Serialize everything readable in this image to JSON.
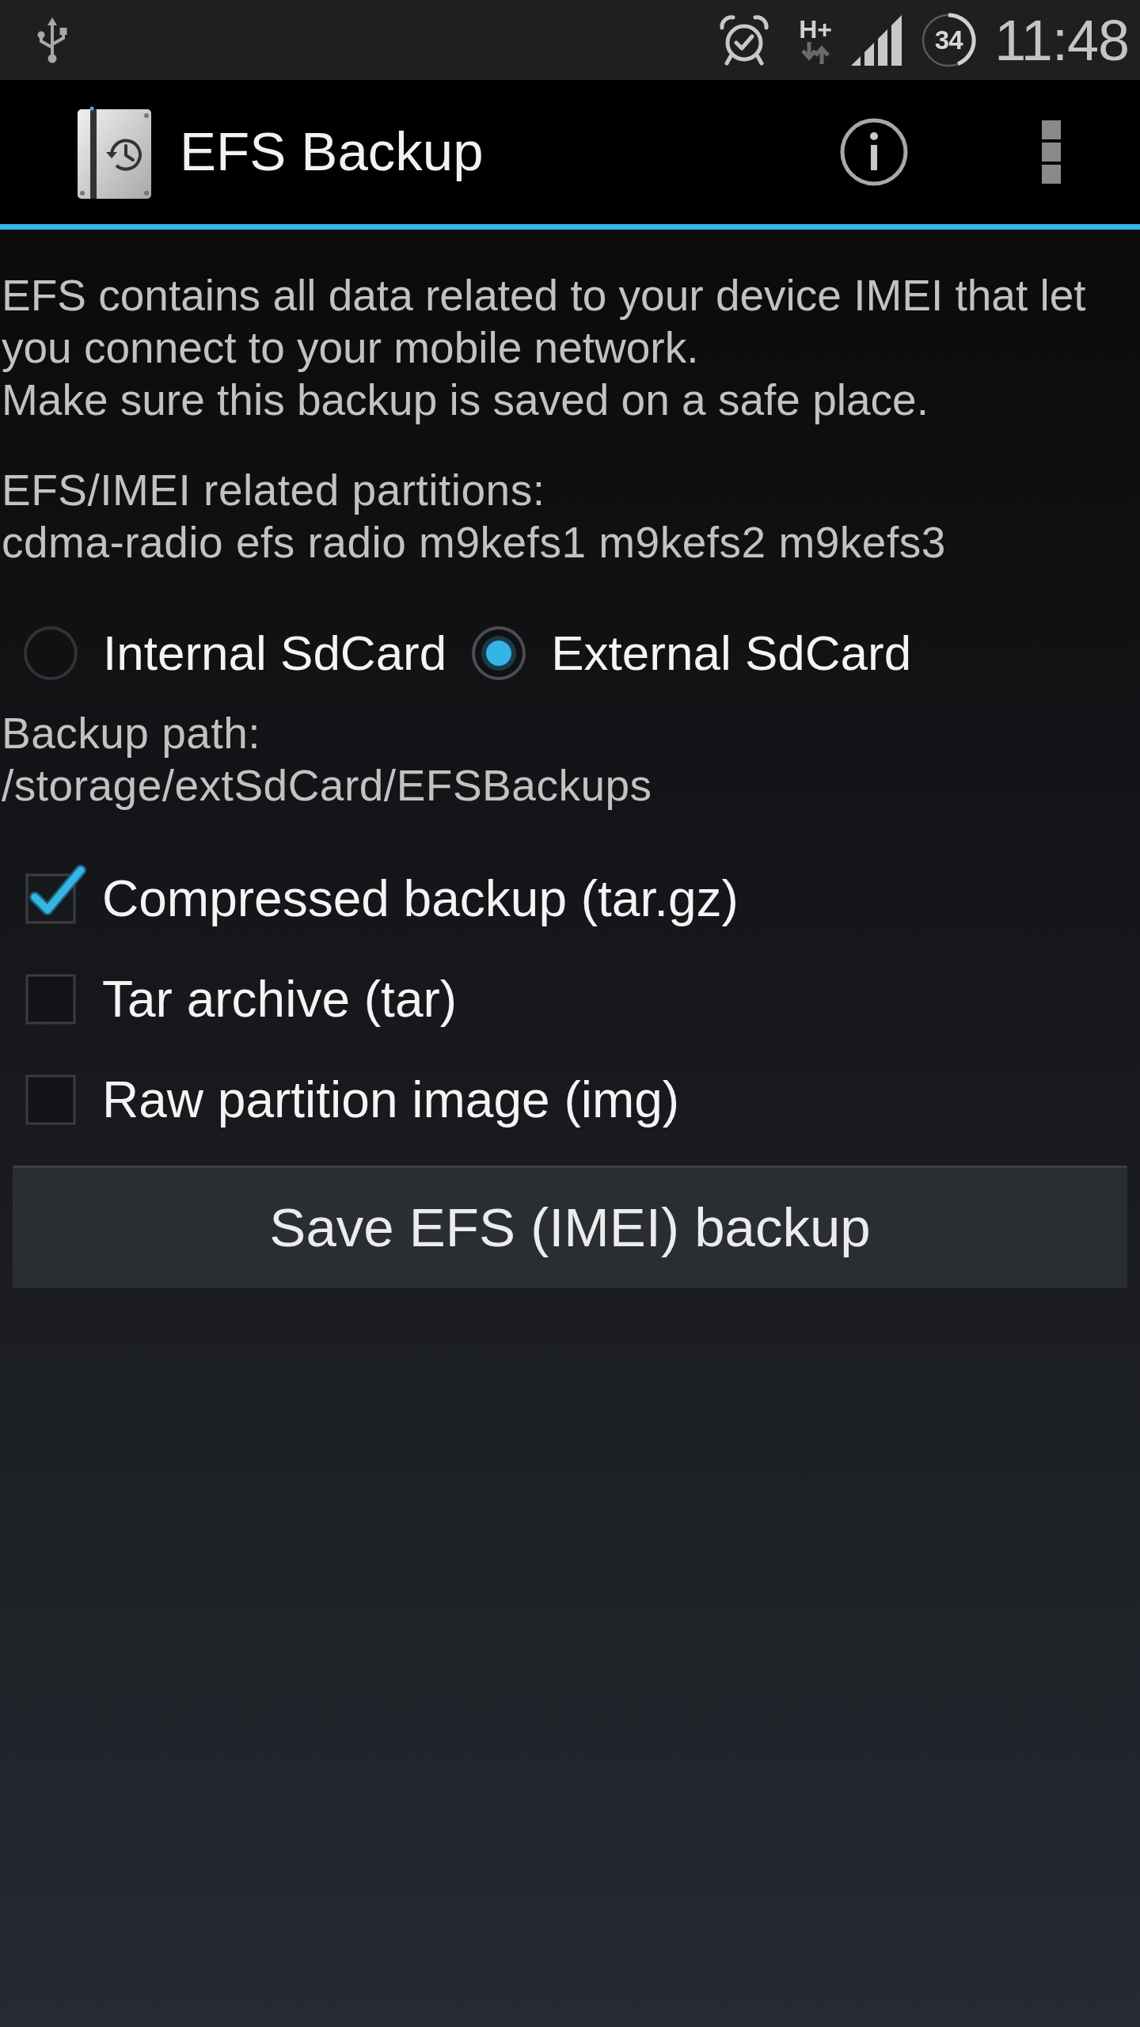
{
  "status_bar": {
    "network_type": "H+",
    "battery": "34",
    "time": "11:48"
  },
  "action_bar": {
    "title": "EFS Backup"
  },
  "description": [
    "EFS contains all data related to your device IMEI that let you connect to your mobile network.",
    "Make sure this backup is saved on a safe place."
  ],
  "partitions": {
    "label": "EFS/IMEI related partitions:",
    "value": "cdma-radio efs radio m9kefs1 m9kefs2 m9kefs3"
  },
  "storage_options": [
    {
      "label": "Internal SdCard",
      "selected": false
    },
    {
      "label": "External SdCard",
      "selected": true
    }
  ],
  "backup_path": {
    "label": "Backup path:",
    "value": "/storage/extSdCard/EFSBackups"
  },
  "formats": [
    {
      "label": "Compressed backup (tar.gz)",
      "checked": true
    },
    {
      "label": "Tar archive (tar)",
      "checked": false
    },
    {
      "label": "Raw partition image (img)",
      "checked": false
    }
  ],
  "save_button": {
    "label": "Save EFS (IMEI) backup"
  }
}
